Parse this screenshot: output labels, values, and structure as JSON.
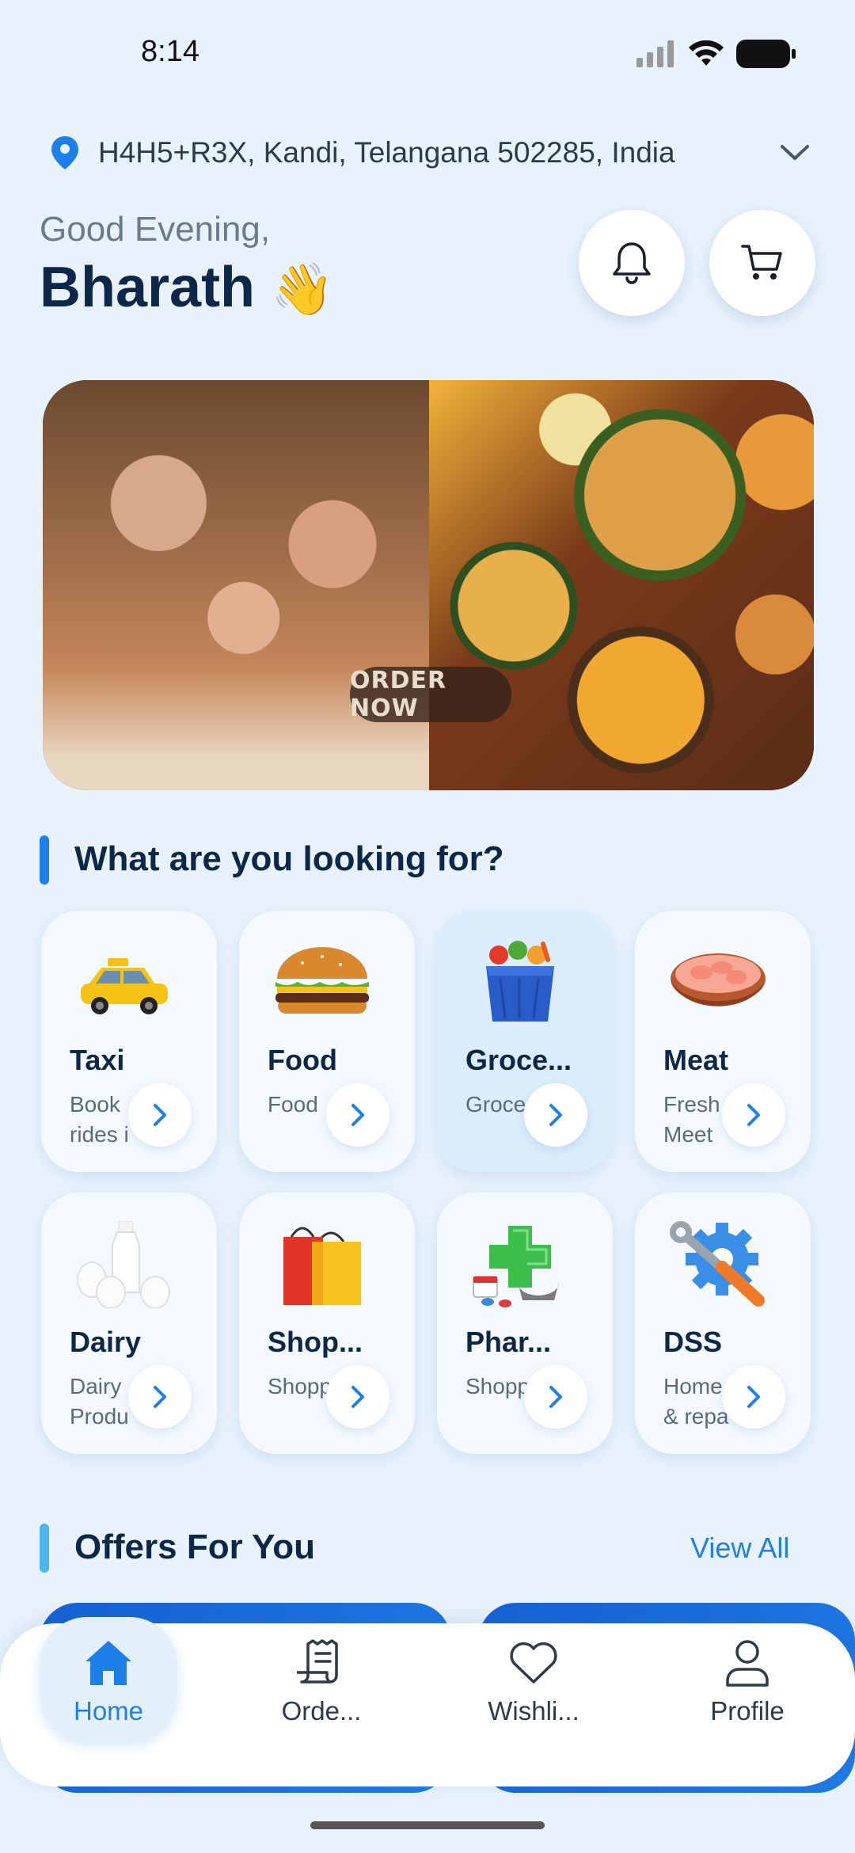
{
  "status_bar": {
    "time": "8:14"
  },
  "location": {
    "address": "H4H5+R3X, Kandi, Telangana 502285, India"
  },
  "greeting": {
    "subtitle": "Good Evening,",
    "name": "Bharath",
    "emoji": "👋"
  },
  "banner": {
    "cta": "ORDER NOW"
  },
  "looking_section": {
    "title": "What are you looking for?"
  },
  "categories": [
    {
      "title": "Taxi",
      "desc": "Book rides i"
    },
    {
      "title": "Food",
      "desc": "Food"
    },
    {
      "title": "Groce...",
      "desc": "Grocer"
    },
    {
      "title": "Meat",
      "desc": "Fresh Meet"
    },
    {
      "title": "Dairy",
      "desc": "Dairy Produ"
    },
    {
      "title": "Shop...",
      "desc": "Shoppi"
    },
    {
      "title": "Phar...",
      "desc": "Shoppi"
    },
    {
      "title": "DSS",
      "desc": "Home & repa"
    }
  ],
  "offers": {
    "title": "Offers For You",
    "view_all": "View All"
  },
  "bottom_nav": [
    {
      "label": "Home",
      "icon": "home-icon",
      "active": true
    },
    {
      "label": "Orde...",
      "icon": "orders-icon",
      "active": false
    },
    {
      "label": "Wishli...",
      "icon": "heart-icon",
      "active": false
    },
    {
      "label": "Profile",
      "icon": "profile-icon",
      "active": false
    }
  ],
  "colors": {
    "accent": "#1e7fe8",
    "text_dark": "#0d2748",
    "background": "#e8f2fc"
  }
}
